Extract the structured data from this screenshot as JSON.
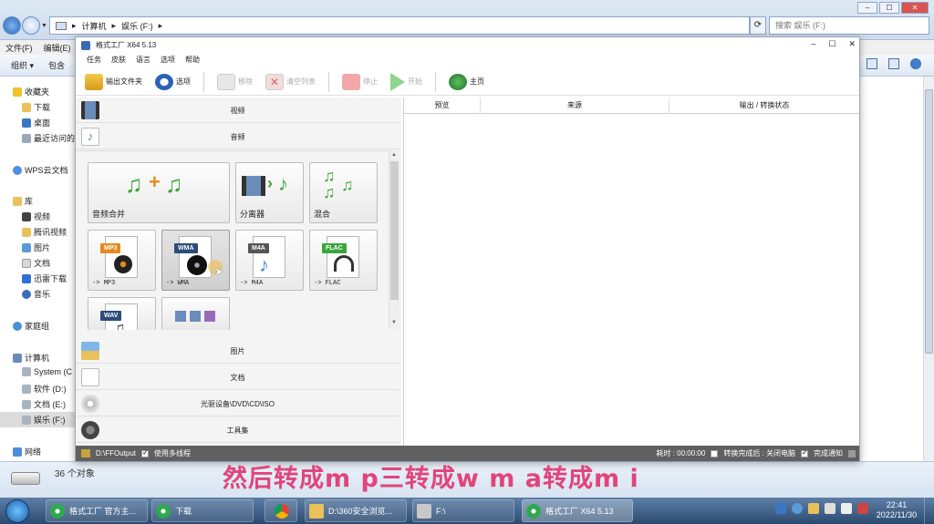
{
  "explorer": {
    "address": {
      "seg1": "计算机",
      "seg2": "娱乐 (F:)",
      "search_placeholder": "搜索 娱乐 (F:)"
    },
    "menu": [
      "文件(F)",
      "编辑(E)"
    ],
    "toolbar": {
      "organize": "组织 ▾",
      "include": "包含"
    },
    "sidebar": {
      "favorites": "收藏夹",
      "downloads": "下载",
      "desktop": "桌面",
      "recent": "最近访问的",
      "wps": "WPS云文档",
      "library": "库",
      "videos": "视频",
      "tencent_video": "腾讯视频",
      "pictures": "图片",
      "documents": "文档",
      "xunlei": "迅雷下载",
      "music": "音乐",
      "homegroup": "家庭组",
      "computer": "计算机",
      "drive_c": "System (C",
      "drive_d": "软件 (D:)",
      "drive_e": "文档 (E:)",
      "drive_f": "娱乐 (F:)",
      "network": "网络"
    },
    "status": {
      "item_count": "36 个对象"
    }
  },
  "ff": {
    "title": "格式工厂 X64 5.13",
    "controls": {
      "minimize": "–",
      "maximize": "☐",
      "close": "✕"
    },
    "menu": [
      "任务",
      "皮肤",
      "语言",
      "选项",
      "帮助"
    ],
    "toolbar": {
      "output_folder": "输出文件夹",
      "options": "选项",
      "remove": "移除",
      "clear_list": "清空列表",
      "stop": "停止",
      "start": "开始",
      "home": "主页"
    },
    "categories": {
      "video": "视频",
      "audio": "音频",
      "picture": "图片",
      "document": "文档",
      "disc": "光驱设备\\DVD\\CD\\ISO",
      "tools": "工具集"
    },
    "tiles": {
      "audio_merge": "音频合并",
      "splitter": "分离器",
      "mix": "混合",
      "mp3": "-> MP3",
      "mp3_badge": "MP3",
      "wma": "-> WMA",
      "wma_badge": "WMA",
      "m4a": "-> M4A",
      "m4a_badge": "M4A",
      "flac": "-> FLAC",
      "flac_badge": "FLAC",
      "wav_badge": "WAV"
    },
    "columns": {
      "preview": "预览",
      "source": "来源",
      "output": "输出 / 转换状态"
    },
    "status": {
      "output_path": "D:\\FFOutput",
      "multithread": "使用多线程",
      "elapsed": "耗时 : 00:00:00",
      "after_convert": "转换完成后 : 关闭电脑",
      "notify": "完成通知"
    }
  },
  "subtitle": "然后转成m p三转成w m a转成m i",
  "taskbar": {
    "tasks": [
      "格式工厂 官方主...",
      "下载",
      "D:\\360安全浏览...",
      "F:\\",
      "格式工厂 X64 5.13"
    ],
    "time": "22:41",
    "date": "2022/11/30"
  },
  "colors": {
    "subtitle": "#e0457b",
    "audio_green": "#3aa63a",
    "mp3_badge": "#e58a1f",
    "wma_badge": "#2c4c7a",
    "m4a_badge": "#555555",
    "flac_badge": "#3aa63a",
    "wav_badge": "#2c4c7a"
  }
}
